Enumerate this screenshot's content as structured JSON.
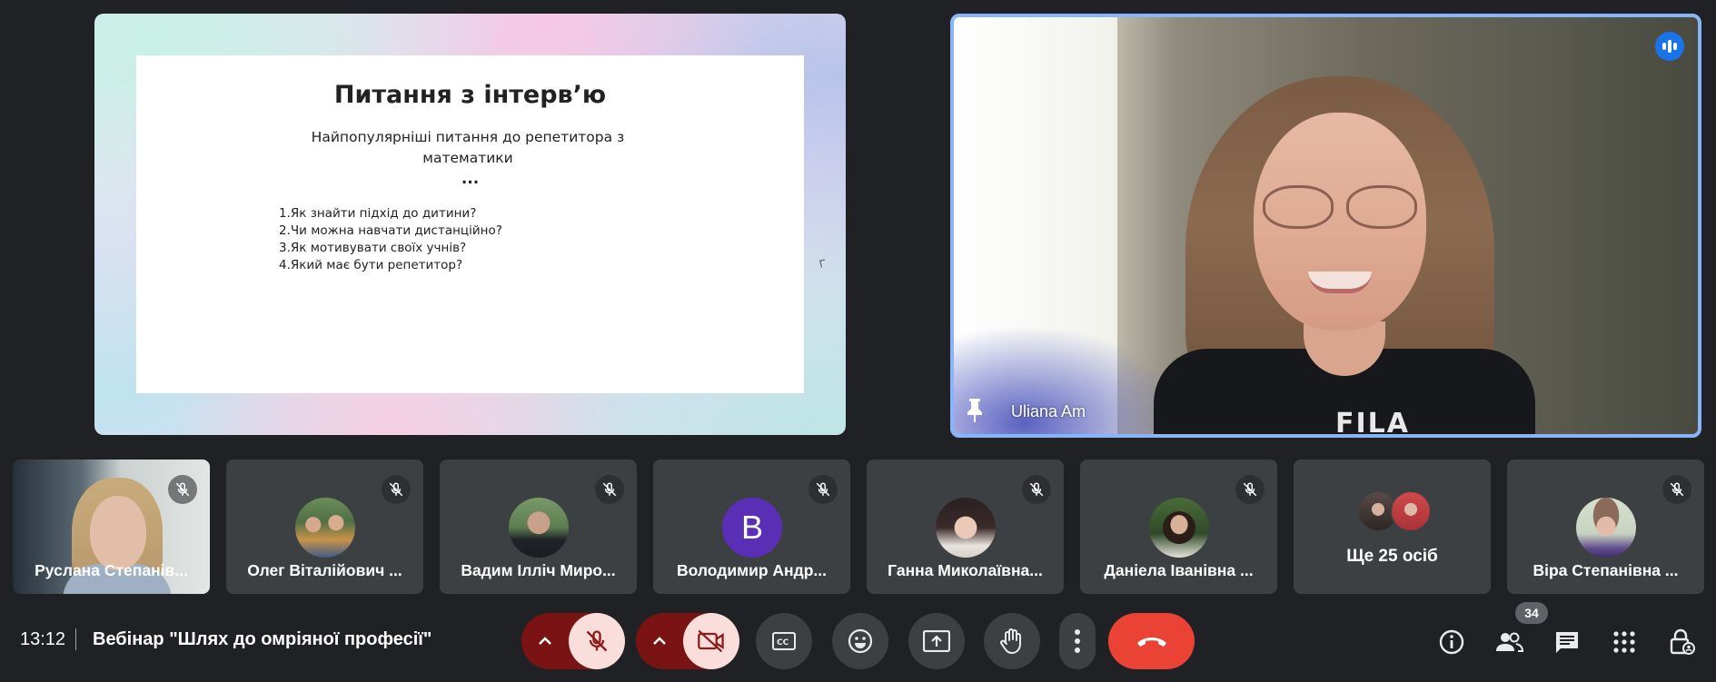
{
  "presentation": {
    "title": "Питання з інтерв’ю",
    "subtitle": "Найпопулярніші питання до репетитора з математики",
    "ellipsis": "...",
    "items": [
      "1.Як знайти підхід до дитини?",
      "2.Чи можна навчати дистанційно?",
      "3.Як мотивувати своїх учнів?",
      "4.Який має бути репетитор?"
    ]
  },
  "speaker": {
    "name": "Uliana Am",
    "shirt_text": "FILA",
    "speaking_icon": "audio-level-icon",
    "pin_icon": "pin-icon"
  },
  "participants": [
    {
      "name": "Руслана Степанів...",
      "muted": true,
      "type": "video"
    },
    {
      "name": "Олег Віталійович ...",
      "muted": true,
      "type": "photo"
    },
    {
      "name": "Вадим Ілліч Миро...",
      "muted": true,
      "type": "photo"
    },
    {
      "name": "Володимир Андр...",
      "muted": true,
      "type": "letter",
      "letter": "B"
    },
    {
      "name": "Ганна Миколаївна...",
      "muted": true,
      "type": "photo"
    },
    {
      "name": "Даніела Іванівна ...",
      "muted": true,
      "type": "photo"
    },
    {
      "name": "Ще 25 осіб",
      "type": "more"
    },
    {
      "name": "Віра Степанівна ...",
      "muted": true,
      "type": "photo"
    }
  ],
  "bottom_bar": {
    "time": "13:12",
    "meeting_title": "Вебінар \"Шлях до омріяної професії\"",
    "people_count": "34",
    "controls": [
      "mic-options",
      "mic-off",
      "camera-options",
      "camera-off",
      "captions",
      "emoji",
      "present",
      "raise-hand",
      "more-options",
      "leave-call"
    ],
    "right_controls": [
      "meeting-details",
      "people",
      "chat",
      "activities",
      "host-controls"
    ]
  },
  "colors": {
    "background": "#202124",
    "tile": "#3c4043",
    "active_border": "#8ab4f8",
    "danger": "#ea4335",
    "danger_bg": "#7a1313",
    "off_button": "#f9dedc"
  }
}
